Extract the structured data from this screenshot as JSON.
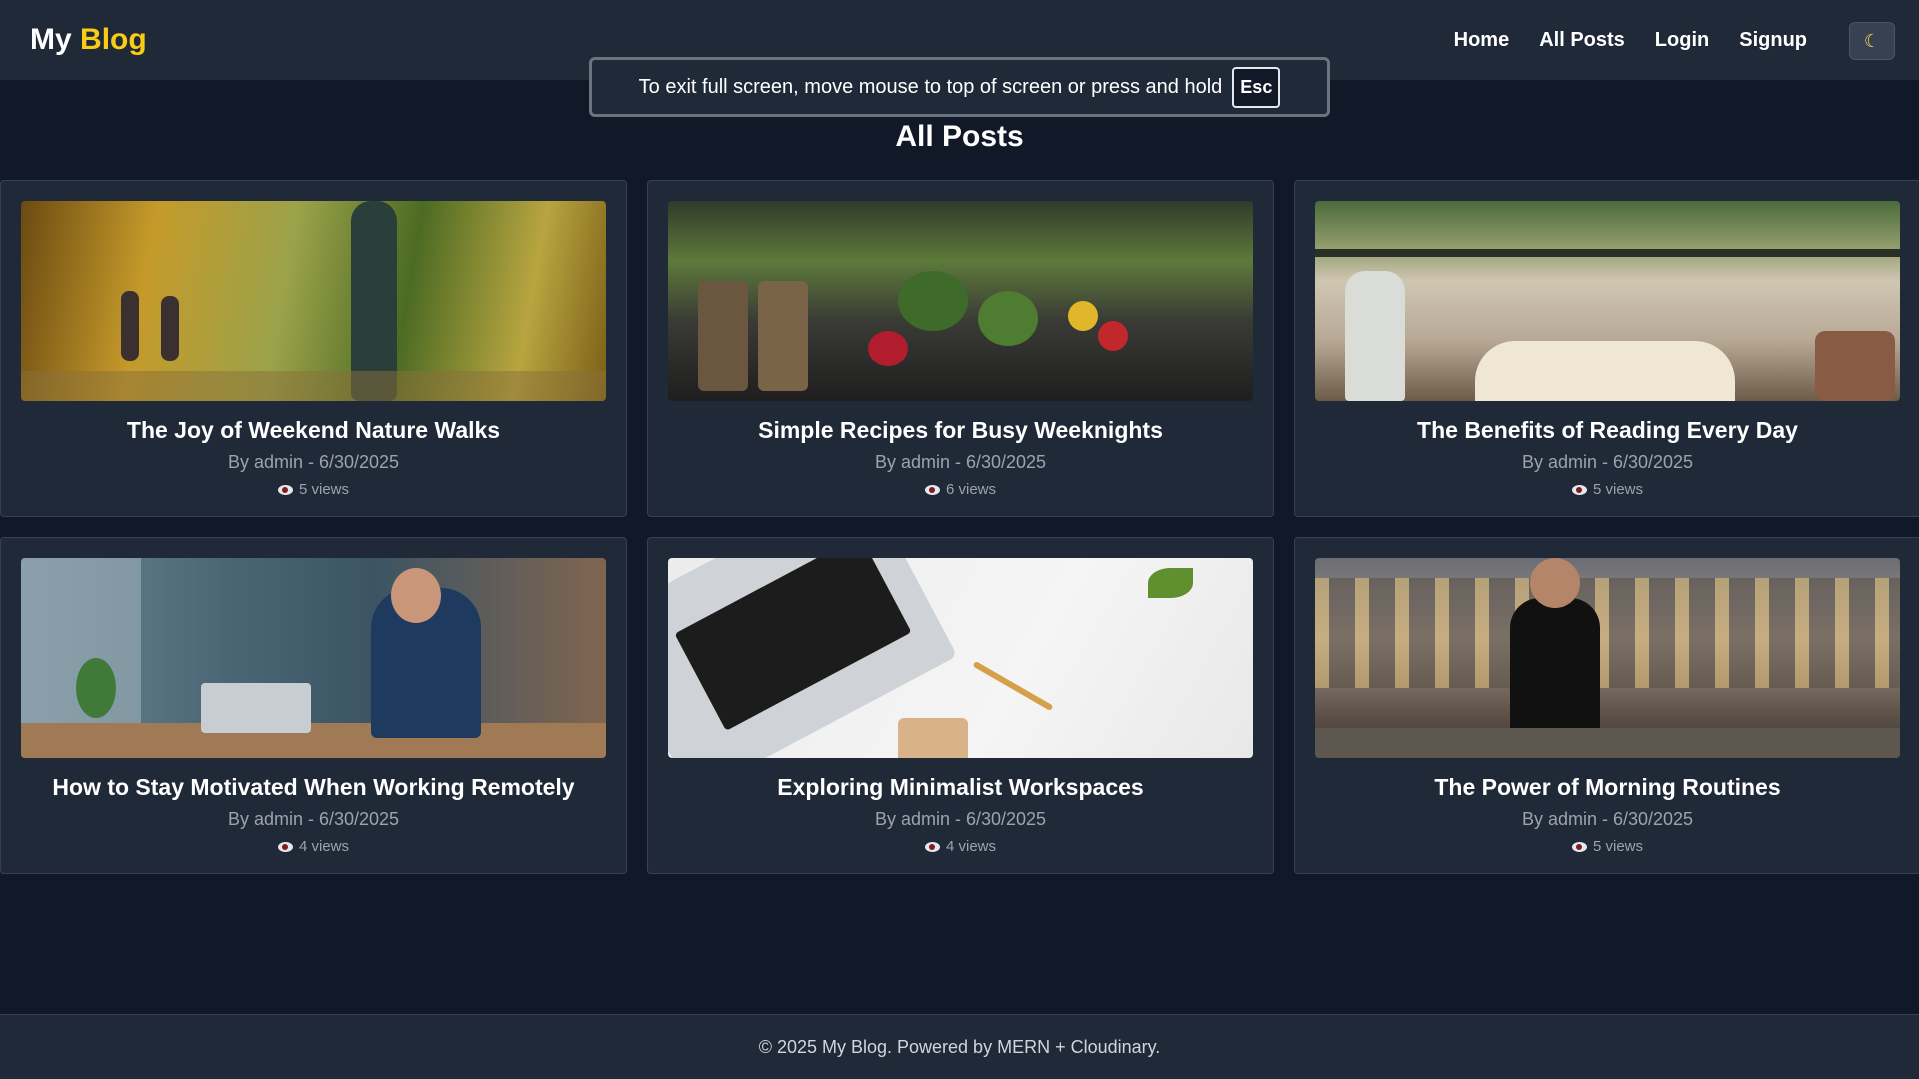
{
  "nav": {
    "brand_main": "My",
    "brand_accent": "Blog",
    "links": [
      "Home",
      "All Posts",
      "Login",
      "Signup"
    ],
    "theme_toggle_icon": "moon-icon"
  },
  "fullscreen_notice": {
    "text": "To exit full screen, move mouse to top of screen or press and hold",
    "key": "Esc"
  },
  "page_title": "All Posts",
  "posts": [
    {
      "title": "The Joy of Weekend Nature Walks",
      "meta": "By admin - 6/30/2025",
      "views": "5 views"
    },
    {
      "title": "Simple Recipes for Busy Weeknights",
      "meta": "By admin - 6/30/2025",
      "views": "6 views"
    },
    {
      "title": "The Benefits of Reading Every Day",
      "meta": "By admin - 6/30/2025",
      "views": "5 views"
    },
    {
      "title": "How to Stay Motivated When Working Remotely",
      "meta": "By admin - 6/30/2025",
      "views": "4 views"
    },
    {
      "title": "Exploring Minimalist Workspaces",
      "meta": "By admin - 6/30/2025",
      "views": "4 views"
    },
    {
      "title": "The Power of Morning Routines",
      "meta": "By admin - 6/30/2025",
      "views": "5 views"
    }
  ],
  "footer": {
    "text": "© 2025 My Blog. Powered by MERN + Cloudinary."
  },
  "colors": {
    "background": "#111827",
    "surface": "#1f2937",
    "accent": "#facc15"
  }
}
